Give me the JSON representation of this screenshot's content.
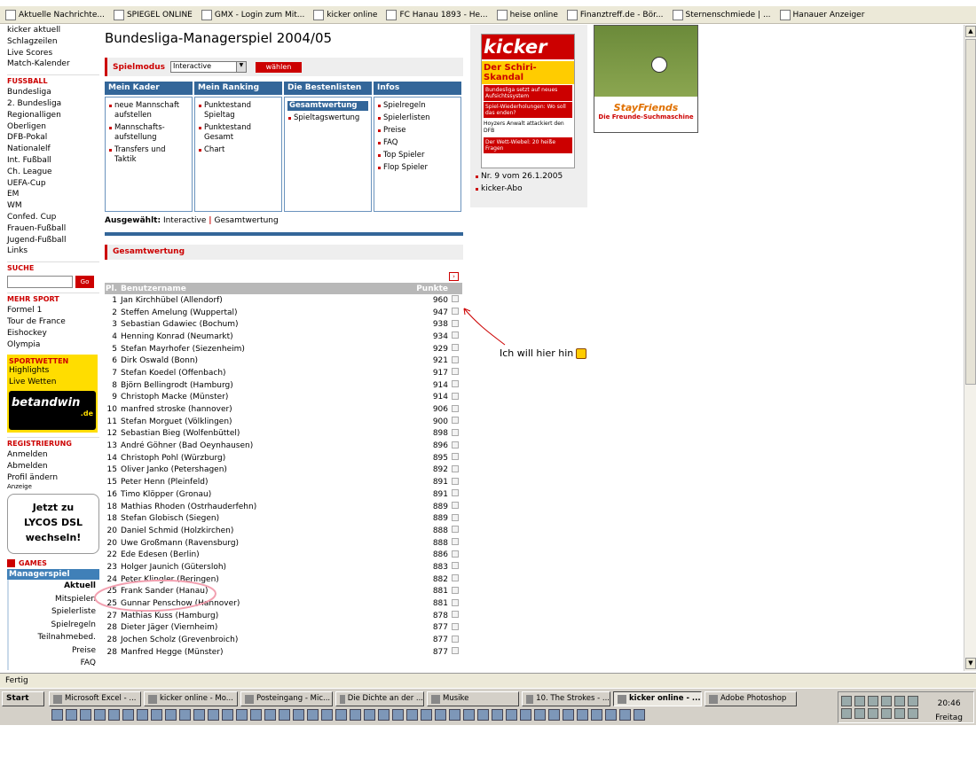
{
  "bookmarks": [
    {
      "label": "Aktuelle Nachrichte..."
    },
    {
      "label": "SPIEGEL ONLINE"
    },
    {
      "label": "GMX - Login zum Mit..."
    },
    {
      "label": "kicker online"
    },
    {
      "label": "FC Hanau 1893 - He..."
    },
    {
      "label": "heise online"
    },
    {
      "label": "Finanztreff.de - Bör..."
    },
    {
      "label": "Sternenschmiede | ..."
    },
    {
      "label": "Hanauer Anzeiger"
    }
  ],
  "leftnav": {
    "top_items": [
      "kicker aktuell",
      "Schlagzeilen",
      "Live Scores",
      "Match-Kalender"
    ],
    "fussball_head": "FUSSBALL",
    "fussball_items": [
      "Bundesliga",
      "2. Bundesliga",
      "Regionalligen",
      "Oberligen",
      "DFB-Pokal",
      "Nationalelf",
      "Int. Fußball",
      "Ch. League",
      "UEFA-Cup",
      "EM",
      "WM",
      "Confed. Cup",
      "Frauen-Fußball",
      "Jugend-Fußball",
      "Links"
    ],
    "suche_head": "SUCHE",
    "go_label": "Go",
    "mehr_head": "MEHR SPORT",
    "mehr_items": [
      "Formel 1",
      "Tour de France",
      "Eishockey",
      "Olympia"
    ],
    "sportwetten_title": "SPORTWETTEN",
    "sportwetten_items": [
      "Highlights",
      "Live Wetten"
    ],
    "bwin_logo": "betandwin",
    "bwin_domain": ".de",
    "reg_head": "REGISTRIERUNG",
    "reg_items": [
      "Anmelden",
      "Abmelden",
      "Profil ändern"
    ],
    "anzeige": "Anzeige",
    "lycos_lines": [
      "Jetzt zu",
      "LYCOS DSL",
      "wechseln!"
    ],
    "games_head": "GAMES",
    "managerspiel_head": "Managerspiel",
    "manager_items": [
      "Aktuell",
      "Mitspielen",
      "Spielerliste",
      "Spielregeln",
      "Teilnahmebed.",
      "Preise",
      "FAQ"
    ]
  },
  "main": {
    "title": "Bundesliga-Managerspiel 2004/05",
    "spielmodus_label": "Spielmodus",
    "spielmodus_value": "Interactive",
    "waehlen_label": "wählen",
    "columns": [
      {
        "head": "Mein Kader",
        "items": [
          "neue Mannschaft aufstellen",
          "Mannschafts-aufstellung",
          "Transfers und Taktik"
        ]
      },
      {
        "head": "Mein Ranking",
        "items": [
          "Punktestand Spieltag",
          "Punktestand Gesamt",
          "Chart"
        ]
      },
      {
        "head": "Die Bestenlisten",
        "selected": "Gesamtwertung",
        "items": [
          "Spieltagswertung"
        ]
      },
      {
        "head": "Infos",
        "items": [
          "Spielregeln",
          "Spielerlisten",
          "Preise",
          "FAQ",
          "Top Spieler",
          "Flop Spieler"
        ]
      }
    ],
    "ausgewaehlt_label": "Ausgewählt:",
    "ausgewaehlt_mode": "Interactive",
    "ausgewaehlt_sep": "|",
    "ausgewaehlt_value": "Gesamtwertung",
    "section_title": "Gesamtwertung",
    "table_headers": {
      "pl": "Pl.",
      "name": "Benutzername",
      "pts": "Punkte"
    },
    "rows": [
      {
        "pl": "1",
        "name": "Jan Kirchhübel (Allendorf)",
        "pts": "960"
      },
      {
        "pl": "2",
        "name": "Steffen Amelung (Wuppertal)",
        "pts": "947"
      },
      {
        "pl": "3",
        "name": "Sebastian Gdawiec (Bochum)",
        "pts": "938"
      },
      {
        "pl": "4",
        "name": "Henning Konrad (Neumarkt)",
        "pts": "934"
      },
      {
        "pl": "5",
        "name": "Stefan Mayrhofer (Siezenheim)",
        "pts": "929"
      },
      {
        "pl": "6",
        "name": "Dirk Oswald (Bonn)",
        "pts": "921"
      },
      {
        "pl": "7",
        "name": "Stefan Koedel (Offenbach)",
        "pts": "917"
      },
      {
        "pl": "8",
        "name": "Björn Bellingrodt (Hamburg)",
        "pts": "914"
      },
      {
        "pl": "9",
        "name": "Christoph Macke (Münster)",
        "pts": "914"
      },
      {
        "pl": "10",
        "name": "manfred stroske (hannover)",
        "pts": "906"
      },
      {
        "pl": "11",
        "name": "Stefan Morguet (Völklingen)",
        "pts": "900"
      },
      {
        "pl": "12",
        "name": "Sebastian Bieg (Wolfenbüttel)",
        "pts": "898"
      },
      {
        "pl": "13",
        "name": "André Göhner (Bad Oeynhausen)",
        "pts": "896"
      },
      {
        "pl": "14",
        "name": "Christoph Pohl (Würzburg)",
        "pts": "895"
      },
      {
        "pl": "15",
        "name": "Oliver Janko (Petershagen)",
        "pts": "892"
      },
      {
        "pl": "15",
        "name": "Peter Henn (Pleinfeld)",
        "pts": "891"
      },
      {
        "pl": "16",
        "name": "Timo Klöpper (Gronau)",
        "pts": "891"
      },
      {
        "pl": "18",
        "name": "Mathias Rhoden (Ostrhauderfehn)",
        "pts": "889"
      },
      {
        "pl": "18",
        "name": "Stefan Globisch (Siegen)",
        "pts": "889"
      },
      {
        "pl": "20",
        "name": "Daniel Schmid (Holzkirchen)",
        "pts": "888"
      },
      {
        "pl": "20",
        "name": "Uwe Großmann (Ravensburg)",
        "pts": "888"
      },
      {
        "pl": "22",
        "name": "Ede Edesen (Berlin)",
        "pts": "886"
      },
      {
        "pl": "23",
        "name": "Holger Jaunich (Gütersloh)",
        "pts": "883"
      },
      {
        "pl": "24",
        "name": "Peter Klingler (Beringen)",
        "pts": "882"
      },
      {
        "pl": "25",
        "name": "Frank Sander (Hanau)",
        "pts": "881"
      },
      {
        "pl": "25",
        "name": "Gunnar Penschow (Hannover)",
        "pts": "881"
      },
      {
        "pl": "27",
        "name": "Mathias Kuss (Hamburg)",
        "pts": "878"
      },
      {
        "pl": "28",
        "name": "Dieter Jäger (Viernheim)",
        "pts": "877"
      },
      {
        "pl": "28",
        "name": "Jochen Scholz (Grevenbroich)",
        "pts": "877"
      },
      {
        "pl": "28",
        "name": "Manfred Hegge (Münster)",
        "pts": "877"
      }
    ]
  },
  "magazine": {
    "logo": "kicker",
    "headline": "Der Schiri-Skandal",
    "lines": [
      "Bundesliga setzt auf neues Aufsichtssystem",
      "Spiel-Wiederholungen: Wo soll das enden?",
      "Hoyzers Anwalt attackiert den DFB",
      "Der Wett-Wiebel: 20 heiße Fragen"
    ],
    "issue": "Nr. 9 vom 26.1.2005",
    "abo": "kicker-Abo"
  },
  "stayfriends": {
    "brand": "StayFriends",
    "tagline": "Die Freunde-Suchmaschine"
  },
  "annotation": "Ich will hier hin",
  "status_text": "Fertig",
  "taskbar": {
    "start": "Start",
    "tasks": [
      "Microsoft Excel - ...",
      "kicker online - Mo...",
      "Posteingang - Mic...",
      "Die Dichte an der ...",
      "Musike",
      "10. The Strokes - ...",
      "kicker online - ...",
      "Adobe Photoshop"
    ],
    "clock_time": "20:46",
    "clock_day": "Freitag"
  }
}
